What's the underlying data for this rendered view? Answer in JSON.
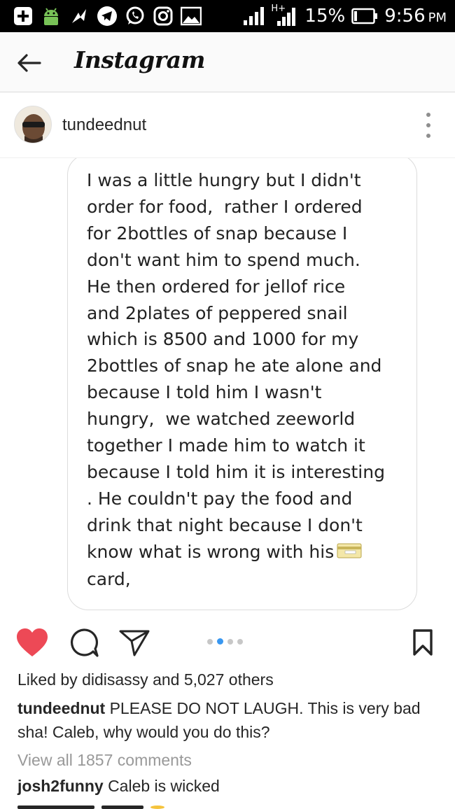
{
  "status_bar": {
    "icons": [
      "add-icon",
      "android-icon",
      "arrow-icon",
      "telegram-icon",
      "whatsapp-icon",
      "instagram-icon",
      "image-icon",
      "signal-icon",
      "h-plus-signal-icon",
      "battery-icon"
    ],
    "network_label": "H+",
    "battery_percent": "15%",
    "time": "9:56",
    "ampm": "PM",
    "battery_level": 0.15
  },
  "app_header": {
    "title": "Instagram"
  },
  "post": {
    "username": "tundeednut",
    "media_lines": [
      "I was a little hungry but I didn't",
      "order for food,  rather I ordered",
      "for 2bottles of snap because I",
      "don't want him to spend much.",
      "He then ordered for jellof rice",
      "and 2plates of peppered snail",
      "which is 8500 and 1000 for my",
      "2bottles of snap he ate alone and",
      "because I told him I wasn't",
      "hungry,  we watched zeeworld",
      "together I made him to watch it",
      "because I told him it is interesting",
      ". He couldn't pay the food and",
      "drink that night because I don't",
      "know what is wrong with his",
      "card,"
    ],
    "media_emoji": "credit-card-emoji",
    "carousel": {
      "total": 4,
      "active_index": 1
    },
    "liked_by_prefix": "Liked by",
    "liked_by_user": "didisassy",
    "liked_by_and": "and",
    "liked_by_count": "5,027 others",
    "caption_user": "tundeednut",
    "caption_text": "PLEASE DO NOT LAUGH. This is very bad sha! Caleb, why would you do this?",
    "view_all_comments": "View all 1857 comments",
    "comments": [
      {
        "user": "josh2funny",
        "text": "Caleb is wicked"
      }
    ]
  },
  "colors": {
    "heart": "#ed4956",
    "active_dot": "#3897f0",
    "muted_text": "#999999"
  }
}
